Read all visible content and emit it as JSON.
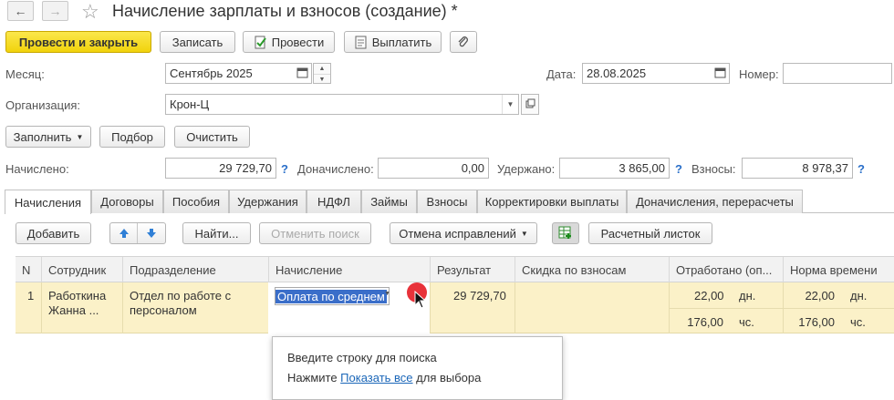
{
  "window": {
    "title": "Начисление зарплаты и взносов (создание) *",
    "star": "☆"
  },
  "toolbar": {
    "post_close": "Провести и закрыть",
    "save": "Записать",
    "post": "Провести",
    "pay": "Выплатить"
  },
  "form": {
    "month_label": "Месяц:",
    "month_value": "Сентябрь 2025",
    "date_label": "Дата:",
    "date_value": "28.08.2025",
    "number_label": "Номер:",
    "number_value": "",
    "org_label": "Организация:",
    "org_value": "Крон-Ц"
  },
  "actions": {
    "fill": "Заполнить",
    "select": "Подбор",
    "clear": "Очистить"
  },
  "totals": {
    "accrued_label": "Начислено:",
    "accrued_value": "29 729,70",
    "additional_label": "Доначислено:",
    "additional_value": "0,00",
    "withheld_label": "Удержано:",
    "withheld_value": "3 865,00",
    "contrib_label": "Взносы:",
    "contrib_value": "8 978,37",
    "help": "?"
  },
  "tabs": [
    "Начисления",
    "Договоры",
    "Пособия",
    "Удержания",
    "НДФЛ",
    "Займы",
    "Взносы",
    "Корректировки выплаты",
    "Доначисления, перерасчеты"
  ],
  "table_toolbar": {
    "add": "Добавить",
    "find": "Найти...",
    "cancel_search": "Отменить поиск",
    "cancel_corrections": "Отмена исправлений",
    "payslip": "Расчетный листок"
  },
  "table": {
    "columns": [
      "N",
      "Сотрудник",
      "Подразделение",
      "Начисление",
      "Результат",
      "Скидка по взносам",
      "Отработано (оп...",
      "Норма времени"
    ],
    "row": {
      "n": "1",
      "employee_line1": "Работкина",
      "employee_line2": "Жанна ...",
      "dept_line1": "Отдел по работе с",
      "dept_line2": "персоналом",
      "accrual": "Оплата по среднем",
      "result": "29 729,70",
      "worked_days": "22,00",
      "worked_days_unit": "дн.",
      "worked_hours": "176,00",
      "worked_hours_unit": "чс.",
      "norm_days": "22,00",
      "norm_days_unit": "дн.",
      "norm_hours": "176,00",
      "norm_hours_unit": "чс."
    }
  },
  "popup": {
    "line1": "Введите строку для поиска",
    "line2_prefix": "Нажмите ",
    "line2_link": "Показать все",
    "line2_suffix": " для выбора"
  }
}
